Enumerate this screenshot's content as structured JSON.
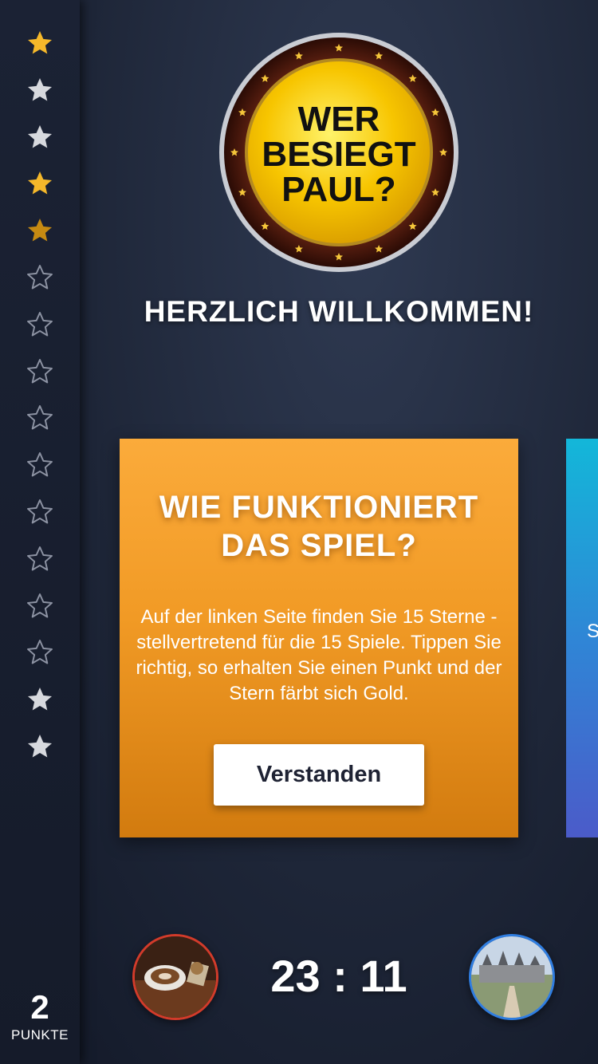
{
  "sidebar": {
    "stars": [
      {
        "state": "gold"
      },
      {
        "state": "silver"
      },
      {
        "state": "silver"
      },
      {
        "state": "gold"
      },
      {
        "state": "dark-gold"
      },
      {
        "state": "empty"
      },
      {
        "state": "empty"
      },
      {
        "state": "empty"
      },
      {
        "state": "empty"
      },
      {
        "state": "empty"
      },
      {
        "state": "empty"
      },
      {
        "state": "empty"
      },
      {
        "state": "empty"
      },
      {
        "state": "empty"
      },
      {
        "state": "silver"
      },
      {
        "state": "silver"
      }
    ],
    "score": {
      "value": "2",
      "label": "PUNKTE"
    }
  },
  "logo": {
    "line1": "WER",
    "line2": "BESIEGT",
    "line3": "PAUL?"
  },
  "welcome": "HERZLICH WILLKOMMEN!",
  "card": {
    "title_line1": "WIE FUNKTIONIERT",
    "title_line2": "DAS SPIEL?",
    "body": "Auf der linken Seite finden Sie 15 Sterne - stellvertretend für die 15 Spiele. Tippen Sie richtig, so erhalten Sie einen Punkt und der Stern färbt sich Gold.",
    "button_label": "Verstanden"
  },
  "next_card_peek": "St",
  "bottom": {
    "timer": "23 : 11",
    "left_avatar": "coffee-photo",
    "right_avatar": "castle-photo"
  },
  "colors": {
    "gold": "#f5b82a",
    "silver": "#d7d9de",
    "card_orange": "#f19a25",
    "card_blue": "#13b7d9"
  }
}
